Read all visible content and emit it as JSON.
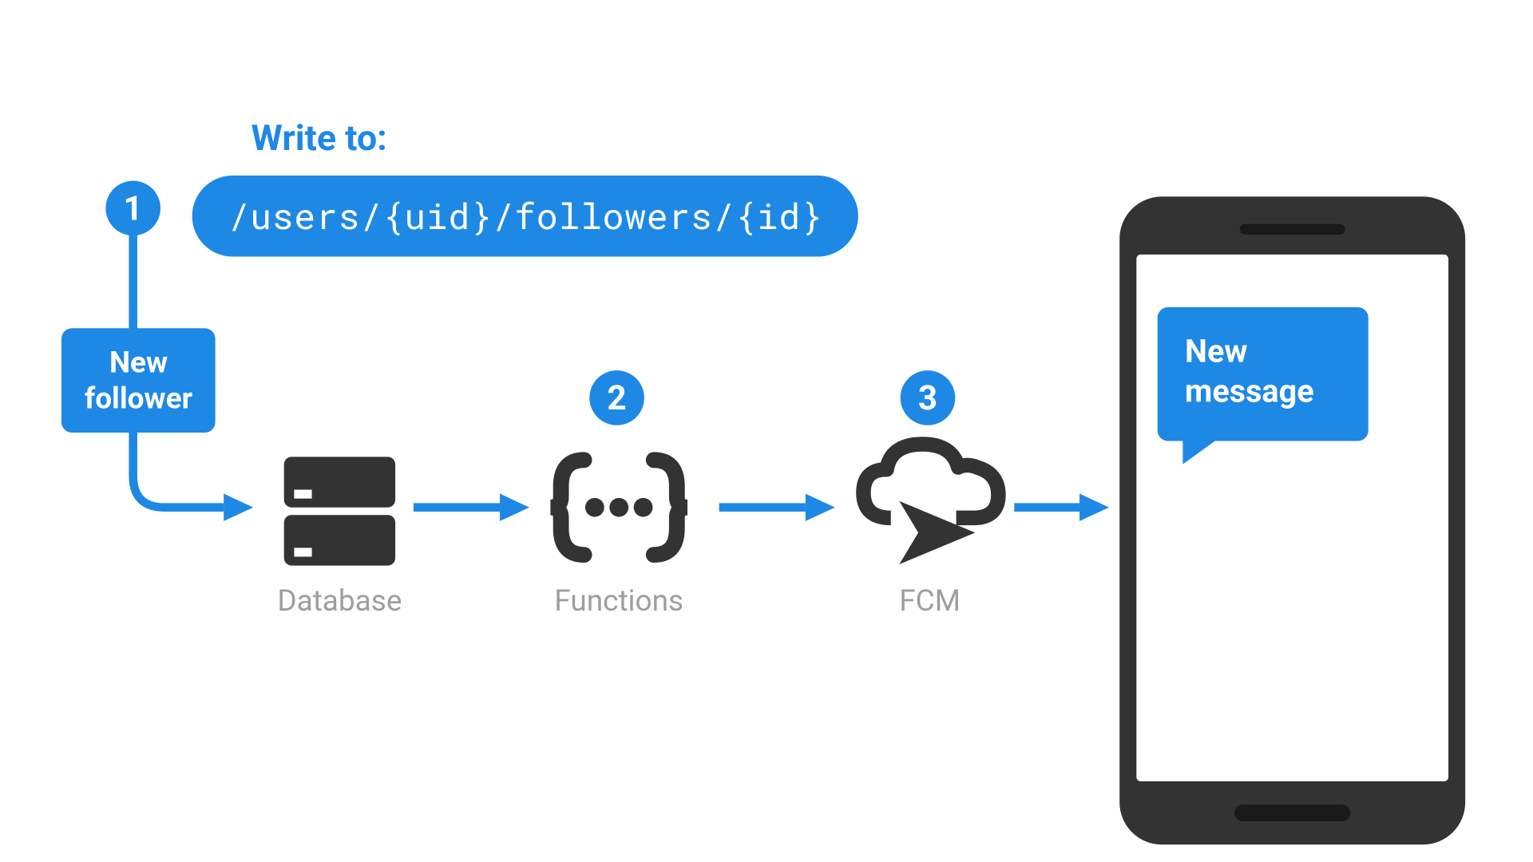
{
  "header": {
    "write_label": "Write to:",
    "path": "/users/{uid}/followers/{id}"
  },
  "badges": {
    "one": "1",
    "two": "2",
    "three": "3"
  },
  "trigger": {
    "line1": "New",
    "line2": "follower"
  },
  "nodes": {
    "database": "Database",
    "functions": "Functions",
    "fcm": "FCM"
  },
  "phone": {
    "bubble_line1": "New",
    "bubble_line2": "message"
  },
  "colors": {
    "accent": "#1e88e5",
    "icon": "#333333",
    "label": "#9e9e9e"
  }
}
